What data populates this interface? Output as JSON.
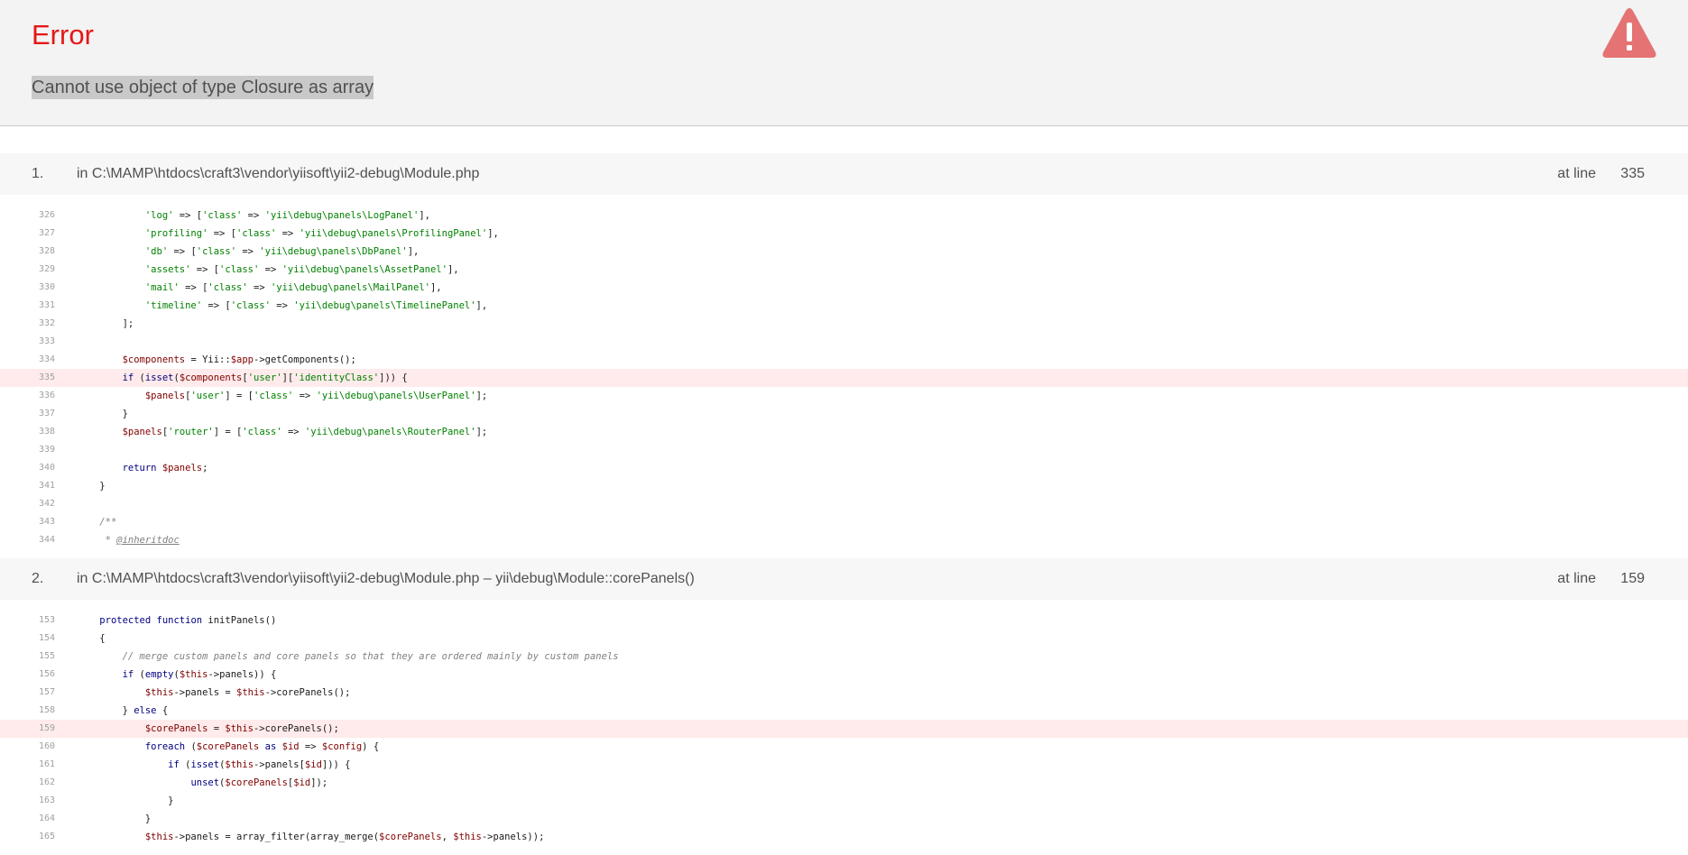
{
  "header": {
    "title": "Error",
    "message": "Cannot use object of type Closure as array",
    "icon": "warning-triangle-icon",
    "accent_color": "#e51717"
  },
  "frames": [
    {
      "number": "1.",
      "location": "in C:\\MAMP\\htdocs\\craft3\\vendor\\yiisoft\\yii2-debug\\Module.php",
      "at_line_label": "at line",
      "line": "335",
      "highlight_line": "335",
      "code": [
        {
          "n": "326",
          "tokens": [
            {
              "t": "p",
              "v": "            "
            },
            {
              "t": "s",
              "v": "'log'"
            },
            {
              "t": "p",
              "v": " => ["
            },
            {
              "t": "s",
              "v": "'class'"
            },
            {
              "t": "p",
              "v": " => "
            },
            {
              "t": "s",
              "v": "'yii\\debug\\panels\\LogPanel'"
            },
            {
              "t": "p",
              "v": "],"
            }
          ]
        },
        {
          "n": "327",
          "tokens": [
            {
              "t": "p",
              "v": "            "
            },
            {
              "t": "s",
              "v": "'profiling'"
            },
            {
              "t": "p",
              "v": " => ["
            },
            {
              "t": "s",
              "v": "'class'"
            },
            {
              "t": "p",
              "v": " => "
            },
            {
              "t": "s",
              "v": "'yii\\debug\\panels\\ProfilingPanel'"
            },
            {
              "t": "p",
              "v": "],"
            }
          ]
        },
        {
          "n": "328",
          "tokens": [
            {
              "t": "p",
              "v": "            "
            },
            {
              "t": "s",
              "v": "'db'"
            },
            {
              "t": "p",
              "v": " => ["
            },
            {
              "t": "s",
              "v": "'class'"
            },
            {
              "t": "p",
              "v": " => "
            },
            {
              "t": "s",
              "v": "'yii\\debug\\panels\\DbPanel'"
            },
            {
              "t": "p",
              "v": "],"
            }
          ]
        },
        {
          "n": "329",
          "tokens": [
            {
              "t": "p",
              "v": "            "
            },
            {
              "t": "s",
              "v": "'assets'"
            },
            {
              "t": "p",
              "v": " => ["
            },
            {
              "t": "s",
              "v": "'class'"
            },
            {
              "t": "p",
              "v": " => "
            },
            {
              "t": "s",
              "v": "'yii\\debug\\panels\\AssetPanel'"
            },
            {
              "t": "p",
              "v": "],"
            }
          ]
        },
        {
          "n": "330",
          "tokens": [
            {
              "t": "p",
              "v": "            "
            },
            {
              "t": "s",
              "v": "'mail'"
            },
            {
              "t": "p",
              "v": " => ["
            },
            {
              "t": "s",
              "v": "'class'"
            },
            {
              "t": "p",
              "v": " => "
            },
            {
              "t": "s",
              "v": "'yii\\debug\\panels\\MailPanel'"
            },
            {
              "t": "p",
              "v": "],"
            }
          ]
        },
        {
          "n": "331",
          "tokens": [
            {
              "t": "p",
              "v": "            "
            },
            {
              "t": "s",
              "v": "'timeline'"
            },
            {
              "t": "p",
              "v": " => ["
            },
            {
              "t": "s",
              "v": "'class'"
            },
            {
              "t": "p",
              "v": " => "
            },
            {
              "t": "s",
              "v": "'yii\\debug\\panels\\TimelinePanel'"
            },
            {
              "t": "p",
              "v": "],"
            }
          ]
        },
        {
          "n": "332",
          "tokens": [
            {
              "t": "p",
              "v": "        ];"
            }
          ]
        },
        {
          "n": "333",
          "tokens": []
        },
        {
          "n": "334",
          "tokens": [
            {
              "t": "p",
              "v": "        "
            },
            {
              "t": "v",
              "v": "$components"
            },
            {
              "t": "p",
              "v": " = Yii::"
            },
            {
              "t": "v",
              "v": "$app"
            },
            {
              "t": "p",
              "v": "->getComponents();"
            }
          ]
        },
        {
          "n": "335",
          "tokens": [
            {
              "t": "p",
              "v": "        "
            },
            {
              "t": "k",
              "v": "if"
            },
            {
              "t": "p",
              "v": " ("
            },
            {
              "t": "k",
              "v": "isset"
            },
            {
              "t": "p",
              "v": "("
            },
            {
              "t": "v",
              "v": "$components"
            },
            {
              "t": "p",
              "v": "["
            },
            {
              "t": "s",
              "v": "'user'"
            },
            {
              "t": "p",
              "v": "]["
            },
            {
              "t": "s",
              "v": "'identityClass'"
            },
            {
              "t": "p",
              "v": "])) {"
            }
          ]
        },
        {
          "n": "336",
          "tokens": [
            {
              "t": "p",
              "v": "            "
            },
            {
              "t": "v",
              "v": "$panels"
            },
            {
              "t": "p",
              "v": "["
            },
            {
              "t": "s",
              "v": "'user'"
            },
            {
              "t": "p",
              "v": "] = ["
            },
            {
              "t": "s",
              "v": "'class'"
            },
            {
              "t": "p",
              "v": " => "
            },
            {
              "t": "s",
              "v": "'yii\\debug\\panels\\UserPanel'"
            },
            {
              "t": "p",
              "v": "];"
            }
          ]
        },
        {
          "n": "337",
          "tokens": [
            {
              "t": "p",
              "v": "        }"
            }
          ]
        },
        {
          "n": "338",
          "tokens": [
            {
              "t": "p",
              "v": "        "
            },
            {
              "t": "v",
              "v": "$panels"
            },
            {
              "t": "p",
              "v": "["
            },
            {
              "t": "s",
              "v": "'router'"
            },
            {
              "t": "p",
              "v": "] = ["
            },
            {
              "t": "s",
              "v": "'class'"
            },
            {
              "t": "p",
              "v": " => "
            },
            {
              "t": "s",
              "v": "'yii\\debug\\panels\\RouterPanel'"
            },
            {
              "t": "p",
              "v": "];"
            }
          ]
        },
        {
          "n": "339",
          "tokens": []
        },
        {
          "n": "340",
          "tokens": [
            {
              "t": "p",
              "v": "        "
            },
            {
              "t": "k",
              "v": "return"
            },
            {
              "t": "p",
              "v": " "
            },
            {
              "t": "v",
              "v": "$panels"
            },
            {
              "t": "p",
              "v": ";"
            }
          ]
        },
        {
          "n": "341",
          "tokens": [
            {
              "t": "p",
              "v": "    }"
            }
          ]
        },
        {
          "n": "342",
          "tokens": []
        },
        {
          "n": "343",
          "tokens": [
            {
              "t": "p",
              "v": "    "
            },
            {
              "t": "c",
              "v": "/**"
            }
          ]
        },
        {
          "n": "344",
          "tokens": [
            {
              "t": "p",
              "v": "     "
            },
            {
              "t": "c",
              "v": "* "
            },
            {
              "t": "d",
              "v": "@inheritdoc"
            }
          ]
        }
      ]
    },
    {
      "number": "2.",
      "location": "in C:\\MAMP\\htdocs\\craft3\\vendor\\yiisoft\\yii2-debug\\Module.php – yii\\debug\\Module::corePanels()",
      "at_line_label": "at line",
      "line": "159",
      "highlight_line": "159",
      "code": [
        {
          "n": "153",
          "tokens": [
            {
              "t": "p",
              "v": "    "
            },
            {
              "t": "k",
              "v": "protected function"
            },
            {
              "t": "p",
              "v": " initPanels()"
            }
          ]
        },
        {
          "n": "154",
          "tokens": [
            {
              "t": "p",
              "v": "    {"
            }
          ]
        },
        {
          "n": "155",
          "tokens": [
            {
              "t": "p",
              "v": "        "
            },
            {
              "t": "c",
              "v": "// merge custom panels and core panels so that they are ordered mainly by custom panels"
            }
          ]
        },
        {
          "n": "156",
          "tokens": [
            {
              "t": "p",
              "v": "        "
            },
            {
              "t": "k",
              "v": "if"
            },
            {
              "t": "p",
              "v": " ("
            },
            {
              "t": "k",
              "v": "empty"
            },
            {
              "t": "p",
              "v": "("
            },
            {
              "t": "v",
              "v": "$this"
            },
            {
              "t": "p",
              "v": "->panels)) {"
            }
          ]
        },
        {
          "n": "157",
          "tokens": [
            {
              "t": "p",
              "v": "            "
            },
            {
              "t": "v",
              "v": "$this"
            },
            {
              "t": "p",
              "v": "->panels = "
            },
            {
              "t": "v",
              "v": "$this"
            },
            {
              "t": "p",
              "v": "->corePanels();"
            }
          ]
        },
        {
          "n": "158",
          "tokens": [
            {
              "t": "p",
              "v": "        } "
            },
            {
              "t": "k",
              "v": "else"
            },
            {
              "t": "p",
              "v": " {"
            }
          ]
        },
        {
          "n": "159",
          "tokens": [
            {
              "t": "p",
              "v": "            "
            },
            {
              "t": "v",
              "v": "$corePanels"
            },
            {
              "t": "p",
              "v": " = "
            },
            {
              "t": "v",
              "v": "$this"
            },
            {
              "t": "p",
              "v": "->corePanels();"
            }
          ]
        },
        {
          "n": "160",
          "tokens": [
            {
              "t": "p",
              "v": "            "
            },
            {
              "t": "k",
              "v": "foreach"
            },
            {
              "t": "p",
              "v": " ("
            },
            {
              "t": "v",
              "v": "$corePanels"
            },
            {
              "t": "p",
              "v": " "
            },
            {
              "t": "k",
              "v": "as"
            },
            {
              "t": "p",
              "v": " "
            },
            {
              "t": "v",
              "v": "$id"
            },
            {
              "t": "p",
              "v": " => "
            },
            {
              "t": "v",
              "v": "$config"
            },
            {
              "t": "p",
              "v": ") {"
            }
          ]
        },
        {
          "n": "161",
          "tokens": [
            {
              "t": "p",
              "v": "                "
            },
            {
              "t": "k",
              "v": "if"
            },
            {
              "t": "p",
              "v": " ("
            },
            {
              "t": "k",
              "v": "isset"
            },
            {
              "t": "p",
              "v": "("
            },
            {
              "t": "v",
              "v": "$this"
            },
            {
              "t": "p",
              "v": "->panels["
            },
            {
              "t": "v",
              "v": "$id"
            },
            {
              "t": "p",
              "v": "])) {"
            }
          ]
        },
        {
          "n": "162",
          "tokens": [
            {
              "t": "p",
              "v": "                    "
            },
            {
              "t": "k",
              "v": "unset"
            },
            {
              "t": "p",
              "v": "("
            },
            {
              "t": "v",
              "v": "$corePanels"
            },
            {
              "t": "p",
              "v": "["
            },
            {
              "t": "v",
              "v": "$id"
            },
            {
              "t": "p",
              "v": "]);"
            }
          ]
        },
        {
          "n": "163",
          "tokens": [
            {
              "t": "p",
              "v": "                }"
            }
          ]
        },
        {
          "n": "164",
          "tokens": [
            {
              "t": "p",
              "v": "            }"
            }
          ]
        },
        {
          "n": "165",
          "tokens": [
            {
              "t": "p",
              "v": "            "
            },
            {
              "t": "v",
              "v": "$this"
            },
            {
              "t": "p",
              "v": "->panels = array_filter(array_merge("
            },
            {
              "t": "v",
              "v": "$corePanels"
            },
            {
              "t": "p",
              "v": ", "
            },
            {
              "t": "v",
              "v": "$this"
            },
            {
              "t": "p",
              "v": "->panels));"
            }
          ]
        }
      ]
    }
  ]
}
